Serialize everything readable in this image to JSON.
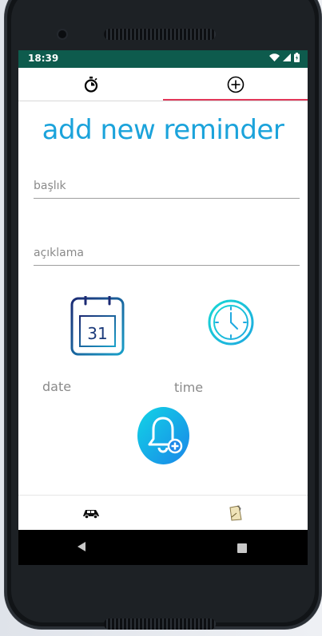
{
  "status_bar": {
    "time": "18:39"
  },
  "tabs": [
    {
      "icon": "stopwatch-icon"
    },
    {
      "icon": "add-circle-icon",
      "selected": true
    }
  ],
  "page": {
    "title": "add new reminder"
  },
  "form": {
    "title_placeholder": "başlık",
    "description_placeholder": "açıklama",
    "date_label": "date",
    "time_label": "time"
  },
  "bottom_nav": [
    {
      "icon": "car-icon"
    },
    {
      "icon": "note-icon"
    }
  ],
  "calendar_icon_day": "31",
  "colors": {
    "accent": "#1ba3db",
    "status_bar": "#0e5b4d",
    "tab_indicator": "#e2385a"
  }
}
